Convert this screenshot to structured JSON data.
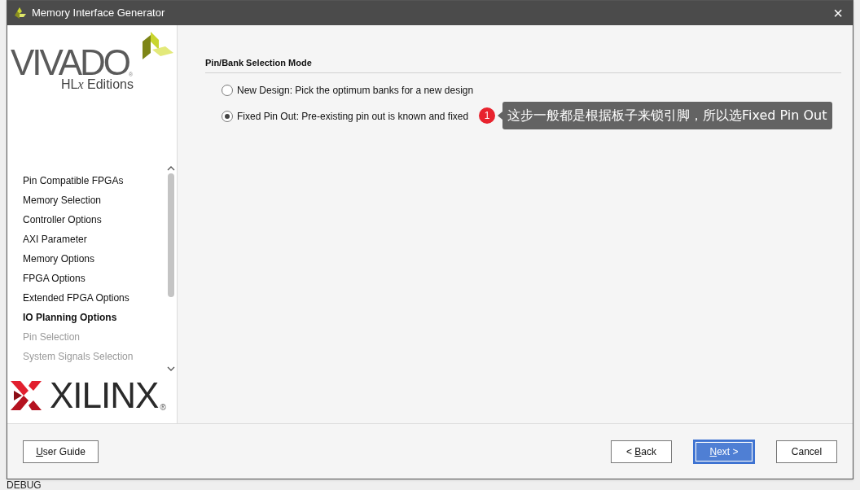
{
  "window": {
    "title": "Memory Interface Generator",
    "close": "×"
  },
  "branding": {
    "product": "VIVADO",
    "registered": "®",
    "edition_prefix": "HL",
    "edition_x": "x",
    "edition_suffix": " Editions",
    "vendor": "XILINX",
    "vendor_registered": "®"
  },
  "steps": [
    {
      "label": "Pin Compatible FPGAs",
      "selected": false,
      "disabled": false
    },
    {
      "label": "Memory Selection",
      "selected": false,
      "disabled": false
    },
    {
      "label": "Controller Options",
      "selected": false,
      "disabled": false
    },
    {
      "label": "AXI Parameter",
      "selected": false,
      "disabled": false
    },
    {
      "label": "Memory Options",
      "selected": false,
      "disabled": false
    },
    {
      "label": "FPGA Options",
      "selected": false,
      "disabled": false
    },
    {
      "label": "Extended FPGA Options",
      "selected": false,
      "disabled": false
    },
    {
      "label": "IO Planning Options",
      "selected": true,
      "disabled": false
    },
    {
      "label": "Pin Selection",
      "selected": false,
      "disabled": true
    },
    {
      "label": "System Signals Selection",
      "selected": false,
      "disabled": true
    }
  ],
  "section": {
    "title": "Pin/Bank Selection Mode",
    "options": [
      {
        "label": "New Design: Pick the optimum banks for a new design",
        "selected": false
      },
      {
        "label": "Fixed Pin Out: Pre-existing pin out is known and fixed",
        "selected": true
      }
    ]
  },
  "annotation": {
    "number": "1",
    "text": "这步一般都是根据板子来锁引脚，所以选Fixed Pin Out"
  },
  "buttons": {
    "user_guide": {
      "mnemonic": "U",
      "rest": "ser Guide"
    },
    "back": {
      "prefix": "< ",
      "mnemonic": "B",
      "rest": "ack"
    },
    "next": {
      "mnemonic": "N",
      "rest": "ext >"
    },
    "cancel": "Cancel"
  },
  "background": {
    "bottom_label": "DEBUG"
  }
}
